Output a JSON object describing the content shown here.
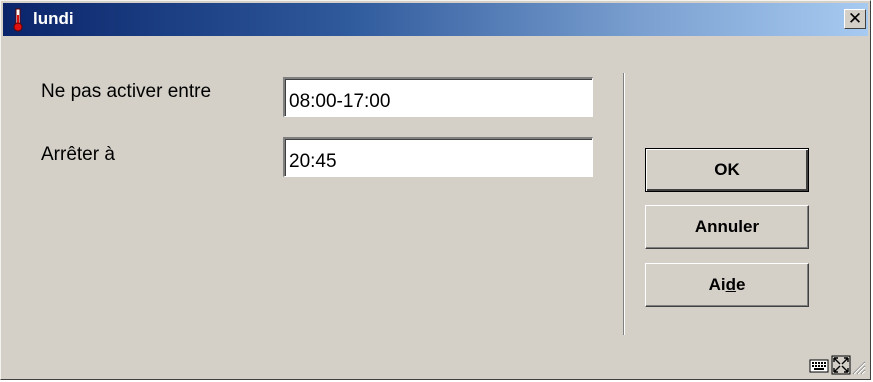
{
  "window": {
    "title": "lundi",
    "close_label": "✕",
    "title_icon": "thermometer-icon"
  },
  "form": {
    "no_activate": {
      "label": "Ne pas activer entre",
      "value": "08:00-17:00"
    },
    "stop_at": {
      "label": "Arrêter à",
      "value": "20:45"
    }
  },
  "buttons": {
    "ok": "OK",
    "cancel": "Annuler",
    "help_pre": "Ai",
    "help_underlined": "d",
    "help_post": "e"
  },
  "status": {
    "icons": [
      "keyboard-icon",
      "fullscreen-icon",
      "resize-grip-icon"
    ]
  },
  "colors": {
    "title_start": "#0a246a",
    "title_end": "#a6caf0",
    "face": "#d4d0c8"
  }
}
